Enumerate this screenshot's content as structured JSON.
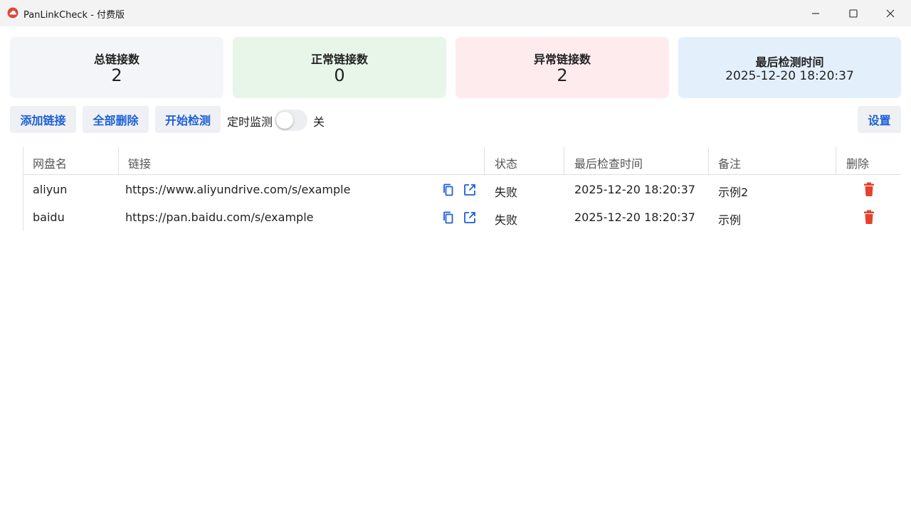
{
  "window": {
    "title": "PanLinkCheck - 付费版"
  },
  "stats": {
    "total": {
      "label": "总链接数",
      "value": "2",
      "bg": "#f3f5f8"
    },
    "normal": {
      "label": "正常链接数",
      "value": "0",
      "bg": "#e8f5e9"
    },
    "abnormal": {
      "label": "异常链接数",
      "value": "2",
      "bg": "#fdebee"
    },
    "last_check": {
      "label": "最后检测时间",
      "value": "2025-12-20 18:20:37",
      "bg": "#e3f0fb"
    }
  },
  "toolbar": {
    "add_label": "添加链接",
    "delete_all_label": "全部删除",
    "start_label": "开始检测",
    "timer_label": "定时监测",
    "timer_state": "关",
    "timer_on": false,
    "settings_label": "设置"
  },
  "table": {
    "headers": {
      "name": "网盘名",
      "link": "链接",
      "status": "状态",
      "last_check": "最后检查时间",
      "note": "备注",
      "delete": "删除"
    },
    "rows": [
      {
        "name": "aliyun",
        "link": "https://www.aliyundrive.com/s/example",
        "status": "失败",
        "last_check": "2025-12-20 18:20:37",
        "note": "示例2"
      },
      {
        "name": "baidu",
        "link": "https://pan.baidu.com/s/example",
        "status": "失败",
        "last_check": "2025-12-20 18:20:37",
        "note": "示例"
      }
    ]
  },
  "colors": {
    "accent": "#1c5fd8",
    "danger": "#e8402c"
  }
}
